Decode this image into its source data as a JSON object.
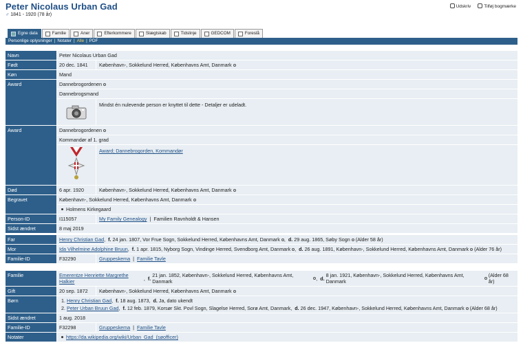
{
  "header": {
    "name": "Peter Nicolaus Urban Gad",
    "gender_symbol": "♂",
    "lifespan": "1841 - 1920  (78 år)",
    "print_label": "Udskriv",
    "bookmark_label": "Tilføj bogmærke"
  },
  "tabs": [
    "Egne data",
    "Familie",
    "Aner",
    "Efterkommere",
    "Slægtskab",
    "Tidslinje",
    "GEDCOM",
    "Foreslå"
  ],
  "subbar": [
    "Personlige oplysninger",
    "Notater",
    "Alle",
    "PDF"
  ],
  "person": {
    "navn_label": "Navn",
    "navn": "Peter Nicolaus Urban Gad",
    "fodt_label": "Født",
    "fodt_date": "20 dec. 1841",
    "fodt_place": "København-, Sokkelund Herred, Københavns Amt, Danmark",
    "kon_label": "Køn",
    "kon": "Mand",
    "award1_label": "Award",
    "award1_a": "Dannebrogordenen",
    "award1_b": "Dannebrogsmand",
    "award1_note": "Mindst én nulevende person er knyttet til dette - Detaljer er udeladt.",
    "award2_label": "Award",
    "award2_a": "Dannebrogordenen",
    "award2_b": "Kommandør af 1. grad",
    "award2_link": "Award; Dannebrogorden, Kommandør",
    "dod_label": "Død",
    "dod_date": "6 apr. 1920",
    "dod_place": "København-, Sokkelund Herred, Københavns Amt, Danmark",
    "begravet_label": "Begravet",
    "begravet_place": "København-, Sokkelund Herred, Københavns Amt, Danmark",
    "begravet_cem": "Holmens Kirkegaard",
    "pid_label": "Person-ID",
    "pid": "I115057",
    "pid_link": "My Family Genealogy",
    "pid_tree": "Familien Ravnholdt & Hansen",
    "changed_label": "Sidst ændret",
    "changed": "8 maj 2019"
  },
  "parents": {
    "far_label": "Far",
    "far_name": "Henry Christian Gad",
    "far_info_b": "f.",
    "far_info": "24 jan. 1807, Vor Frue Sogn, Sokkelund Herred, Københavns Amt, Danmark",
    "far_d_b": "d.",
    "far_d": "29 aug. 1865, Søby Sogn",
    "far_age": "(Alder 58 år)",
    "mor_label": "Mor",
    "mor_name": "Ida Vilhelmine Adolphine Bruun",
    "mor_info_b": "f.",
    "mor_info": "1 apr. 1815, Nyborg Sogn, Vindinge Herred, Svendborg Amt, Danmark",
    "mor_d_b": "d.",
    "mor_d": "26 aug. 1891, København-, Sokkelund Herred, Københavns Amt, Danmark",
    "mor_age": "(Alder 76 år)",
    "fid_label": "Familie-ID",
    "fid": "F32290",
    "chart": "Gruppeskema",
    "tavle": "Familie Tavle"
  },
  "family": {
    "fam_label": "Familie",
    "spouse": "Emerentze Henriette Margrethe Halkier",
    "sp_f_b": "f.",
    "sp_f": "21 jan. 1852, København-, Sokkelund Herred, Københavns Amt, Danmark",
    "sp_d_b": "d.",
    "sp_d": "8 jan. 1921, København-, Sokkelund Herred, Københavns Amt, Danmark",
    "sp_age": "(Alder 68 år)",
    "gift_label": "Gift",
    "gift_date": "20 sep. 1872",
    "gift_place": "København-, Sokkelund Herred, Københavns Amt, Danmark",
    "born_label": "Børn",
    "child1_num": "1.",
    "child1": "Henry Christian Gad",
    "child1_f_b": "f.",
    "child1_f": "18 aug. 1873",
    "child1_d_b": "d.",
    "child1_d": "Ja, dato ukendt",
    "child2_num": "2.",
    "child2": "Peter Urban Bruun Gad",
    "child2_f_b": "f.",
    "child2_f": "12 feb. 1879, Korsør Skt. Povl Sogn, Slagelse Herred, Sorø Amt, Danmark",
    "child2_d_b": "d.",
    "child2_d": "26 dec. 1947, København-, Sokkelund Herred, Københavns Amt, Danmark",
    "child2_age": "(Alder 68 år)",
    "changed_label": "Sidst ændret",
    "changed": "1 aug. 2018",
    "fid_label": "Familie-ID",
    "fid": "F32298",
    "chart": "Gruppeskema",
    "tavle": "Familie Tavle"
  },
  "notes": {
    "label": "Notater",
    "link": "https://da.wikipedia.org/wiki/Urban_Gad_(søofficer)"
  }
}
